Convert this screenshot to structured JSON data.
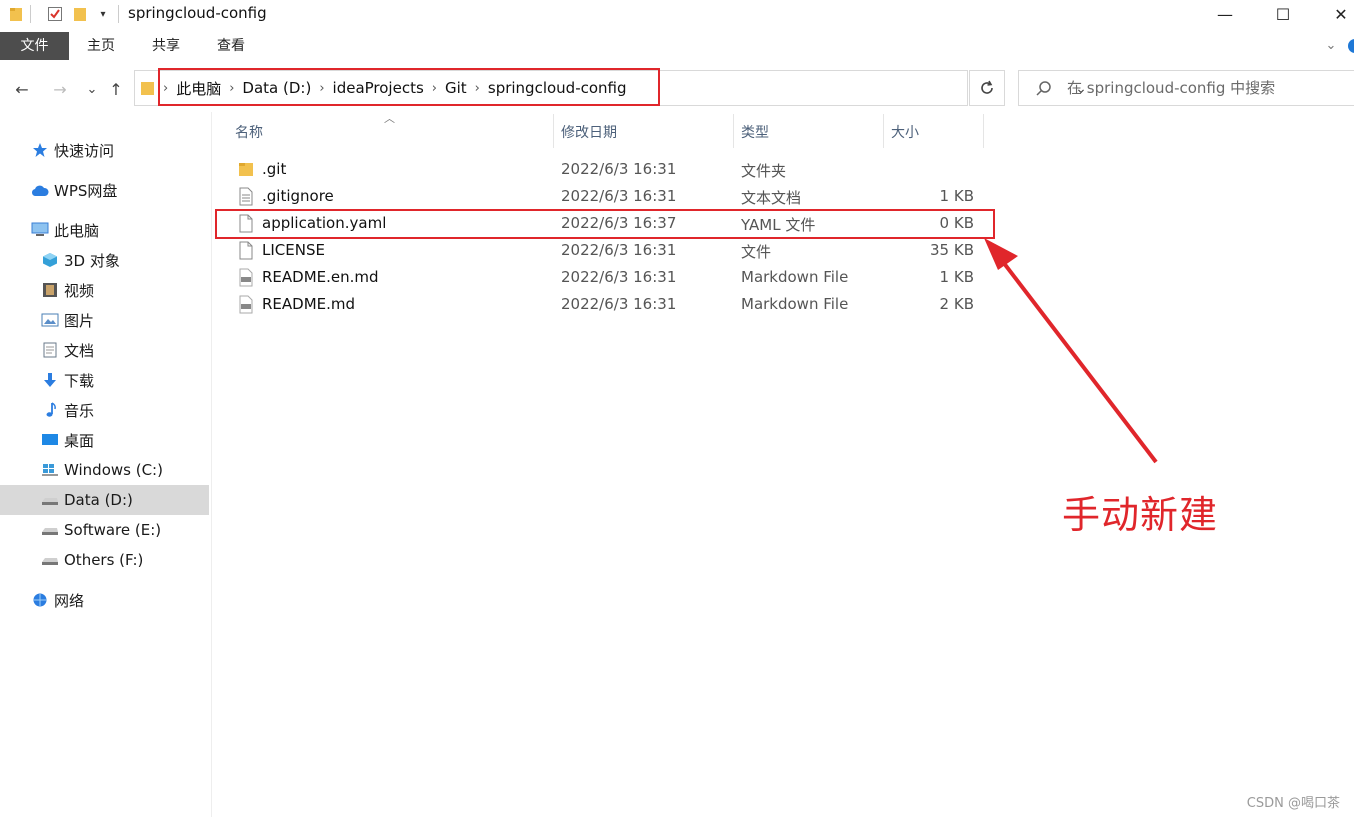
{
  "window": {
    "title": "springcloud-config",
    "controls": {
      "minimize": "—",
      "maximize": "☐",
      "close": "✕"
    }
  },
  "ribbon": {
    "tabs": [
      "文件",
      "主页",
      "共享",
      "查看"
    ]
  },
  "nav": {
    "back": "←",
    "forward": "→",
    "recent": "⌄",
    "up": "↑"
  },
  "address": {
    "crumbs": [
      "此电脑",
      "Data (D:)",
      "ideaProjects",
      "Git",
      "springcloud-config"
    ],
    "separator": "›"
  },
  "search": {
    "placeholder": "在 springcloud-config 中搜索"
  },
  "sidebar": {
    "items": [
      {
        "label": "快速访问",
        "icon": "star-icon",
        "color": "#2b7de0"
      },
      {
        "label": "WPS网盘",
        "icon": "cloud-icon",
        "color": "#2b7de0"
      },
      {
        "label": "此电脑",
        "icon": "computer-icon",
        "color": "#3a7fd5"
      },
      {
        "label": "3D 对象",
        "icon": "cube-icon",
        "color": "#34a0d8"
      },
      {
        "label": "视频",
        "icon": "film-icon",
        "color": "#555555"
      },
      {
        "label": "图片",
        "icon": "picture-icon",
        "color": "#4a7fb5"
      },
      {
        "label": "文档",
        "icon": "document-icon",
        "color": "#6a7a8a"
      },
      {
        "label": "下载",
        "icon": "download-icon",
        "color": "#2b7de0"
      },
      {
        "label": "音乐",
        "icon": "music-icon",
        "color": "#2b7de0"
      },
      {
        "label": "桌面",
        "icon": "desktop-icon",
        "color": "#1e88e5"
      },
      {
        "label": "Windows (C:)",
        "icon": "windows-drive-icon",
        "color": "#3a9ad9"
      },
      {
        "label": "Data (D:)",
        "icon": "drive-icon",
        "color": "#777777",
        "selected": true
      },
      {
        "label": "Software (E:)",
        "icon": "drive-icon",
        "color": "#777777"
      },
      {
        "label": "Others (F:)",
        "icon": "drive-icon",
        "color": "#777777"
      },
      {
        "label": "网络",
        "icon": "network-icon",
        "color": "#2b7de0"
      }
    ]
  },
  "columns": {
    "name": "名称",
    "date": "修改日期",
    "type": "类型",
    "size": "大小"
  },
  "files": [
    {
      "name": ".git",
      "date": "2022/6/3 16:31",
      "type": "文件夹",
      "size": "",
      "icon": "folder-icon"
    },
    {
      "name": ".gitignore",
      "date": "2022/6/3 16:31",
      "type": "文本文档",
      "size": "1 KB",
      "icon": "text-file-icon"
    },
    {
      "name": "application.yaml",
      "date": "2022/6/3 16:37",
      "type": "YAML 文件",
      "size": "0 KB",
      "icon": "blank-file-icon"
    },
    {
      "name": "LICENSE",
      "date": "2022/6/3 16:31",
      "type": "文件",
      "size": "35 KB",
      "icon": "blank-file-icon"
    },
    {
      "name": "README.en.md",
      "date": "2022/6/3 16:31",
      "type": "Markdown File",
      "size": "1 KB",
      "icon": "markdown-file-icon"
    },
    {
      "name": "README.md",
      "date": "2022/6/3 16:31",
      "type": "Markdown File",
      "size": "2 KB",
      "icon": "markdown-file-icon"
    }
  ],
  "annotation": {
    "text": "手动新建",
    "color": "#e0262b"
  },
  "watermark": "CSDN @喝口茶"
}
